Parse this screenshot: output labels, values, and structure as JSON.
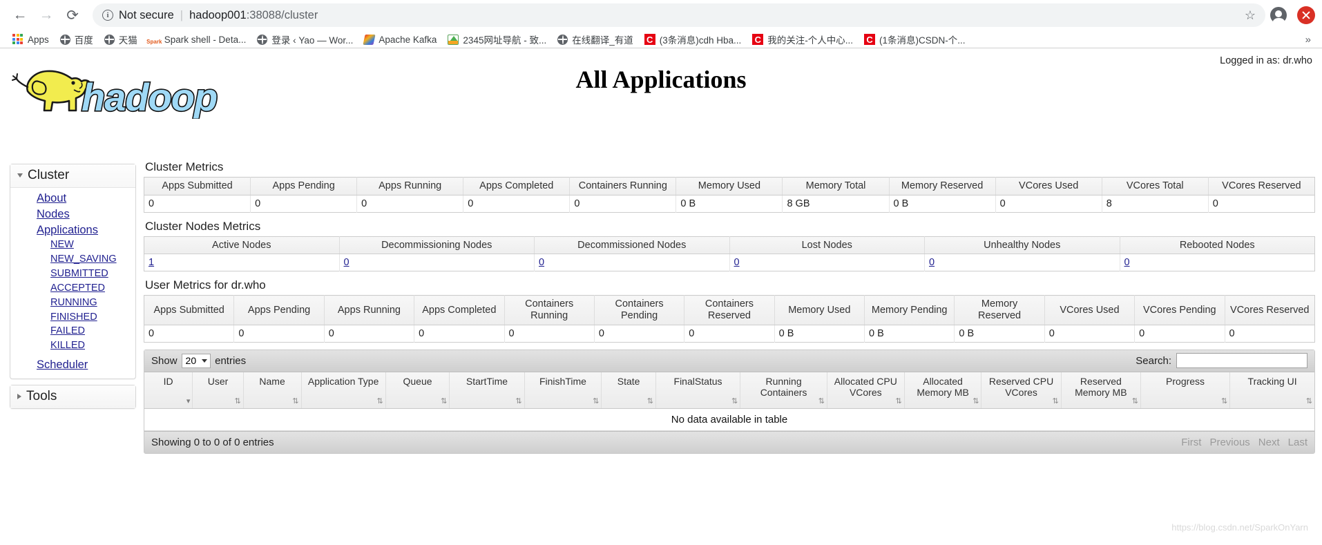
{
  "browser": {
    "back_icon": "arrow-left-icon",
    "forward_icon": "arrow-right-icon",
    "reload_icon": "reload-icon",
    "security_label": "Not secure",
    "url_host": "hadoop001",
    "url_rest": ":38088/cluster",
    "star_glyph": "☆",
    "overflow_glyph": "»",
    "bookmarks": [
      {
        "label": "Apps",
        "icon": "apps-grid-icon"
      },
      {
        "label": "百度",
        "icon": "globe-icon"
      },
      {
        "label": "天猫",
        "icon": "globe-icon"
      },
      {
        "label": "Spark shell - Deta...",
        "icon": "spark-icon"
      },
      {
        "label": "登录 ‹ Yao — Wor...",
        "icon": "globe-icon"
      },
      {
        "label": "Apache Kafka",
        "icon": "kafka-icon"
      },
      {
        "label": "2345网址导航 - 致...",
        "icon": "nav2345-icon"
      },
      {
        "label": "在线翻译_有道",
        "icon": "globe-icon"
      },
      {
        "label": "(3条消息)cdh Hba...",
        "icon": "csdn-icon"
      },
      {
        "label": "我的关注-个人中心...",
        "icon": "csdn-icon"
      },
      {
        "label": "(1条消息)CSDN-个...",
        "icon": "csdn-icon"
      }
    ]
  },
  "header": {
    "title": "All Applications",
    "logged_in": "Logged in as: dr.who",
    "logo_text": "hadoop"
  },
  "sidebar": {
    "cluster": {
      "label": "Cluster",
      "items": [
        {
          "label": "About"
        },
        {
          "label": "Nodes"
        },
        {
          "label": "Applications"
        }
      ],
      "app_states": [
        {
          "label": "NEW"
        },
        {
          "label": "NEW_SAVING"
        },
        {
          "label": "SUBMITTED"
        },
        {
          "label": "ACCEPTED"
        },
        {
          "label": "RUNNING"
        },
        {
          "label": "FINISHED"
        },
        {
          "label": "FAILED"
        },
        {
          "label": "KILLED"
        }
      ],
      "scheduler": {
        "label": "Scheduler"
      }
    },
    "tools": {
      "label": "Tools"
    }
  },
  "cluster_metrics": {
    "title": "Cluster Metrics",
    "headers": [
      "Apps Submitted",
      "Apps Pending",
      "Apps Running",
      "Apps Completed",
      "Containers Running",
      "Memory Used",
      "Memory Total",
      "Memory Reserved",
      "VCores Used",
      "VCores Total",
      "VCores Reserved"
    ],
    "values": [
      "0",
      "0",
      "0",
      "0",
      "0",
      "0 B",
      "8 GB",
      "0 B",
      "0",
      "8",
      "0"
    ]
  },
  "cluster_nodes_metrics": {
    "title": "Cluster Nodes Metrics",
    "headers": [
      "Active Nodes",
      "Decommissioning Nodes",
      "Decommissioned Nodes",
      "Lost Nodes",
      "Unhealthy Nodes",
      "Rebooted Nodes"
    ],
    "values": [
      "1",
      "0",
      "0",
      "0",
      "0",
      "0"
    ]
  },
  "user_metrics": {
    "title": "User Metrics for dr.who",
    "headers": [
      "Apps Submitted",
      "Apps Pending",
      "Apps Running",
      "Apps Completed",
      "Containers Running",
      "Containers Pending",
      "Containers Reserved",
      "Memory Used",
      "Memory Pending",
      "Memory Reserved",
      "VCores Used",
      "VCores Pending",
      "VCores Reserved"
    ],
    "values": [
      "0",
      "0",
      "0",
      "0",
      "0",
      "0",
      "0",
      "0 B",
      "0 B",
      "0 B",
      "0",
      "0",
      "0"
    ]
  },
  "applications_table": {
    "show_label": "Show",
    "entries_label": "entries",
    "page_length": "20",
    "search_label": "Search:",
    "search_value": "",
    "search_placeholder": "",
    "columns": [
      {
        "label": "ID",
        "sort": "desc"
      },
      {
        "label": "User",
        "sort": "both"
      },
      {
        "label": "Name",
        "sort": "both"
      },
      {
        "label": "Application Type",
        "sort": "both"
      },
      {
        "label": "Queue",
        "sort": "both"
      },
      {
        "label": "StartTime",
        "sort": "both"
      },
      {
        "label": "FinishTime",
        "sort": "both"
      },
      {
        "label": "State",
        "sort": "both"
      },
      {
        "label": "FinalStatus",
        "sort": "both"
      },
      {
        "label": "Running Containers",
        "sort": "both"
      },
      {
        "label": "Allocated CPU VCores",
        "sort": "both"
      },
      {
        "label": "Allocated Memory MB",
        "sort": "both"
      },
      {
        "label": "Reserved CPU VCores",
        "sort": "both"
      },
      {
        "label": "Reserved Memory MB",
        "sort": "both"
      },
      {
        "label": "Progress",
        "sort": "both"
      },
      {
        "label": "Tracking UI",
        "sort": "both"
      }
    ],
    "empty_message": "No data available in table",
    "info": "Showing 0 to 0 of 0 entries",
    "pager": [
      "First",
      "Previous",
      "Next",
      "Last"
    ]
  },
  "watermark": "https://blog.csdn.net/SparkOnYarn",
  "colors": {
    "link": "#1f1f8f",
    "logo_yellow": "#f2ec4e",
    "logo_blue": "#9fd9f6",
    "accent_red": "#d93025"
  }
}
